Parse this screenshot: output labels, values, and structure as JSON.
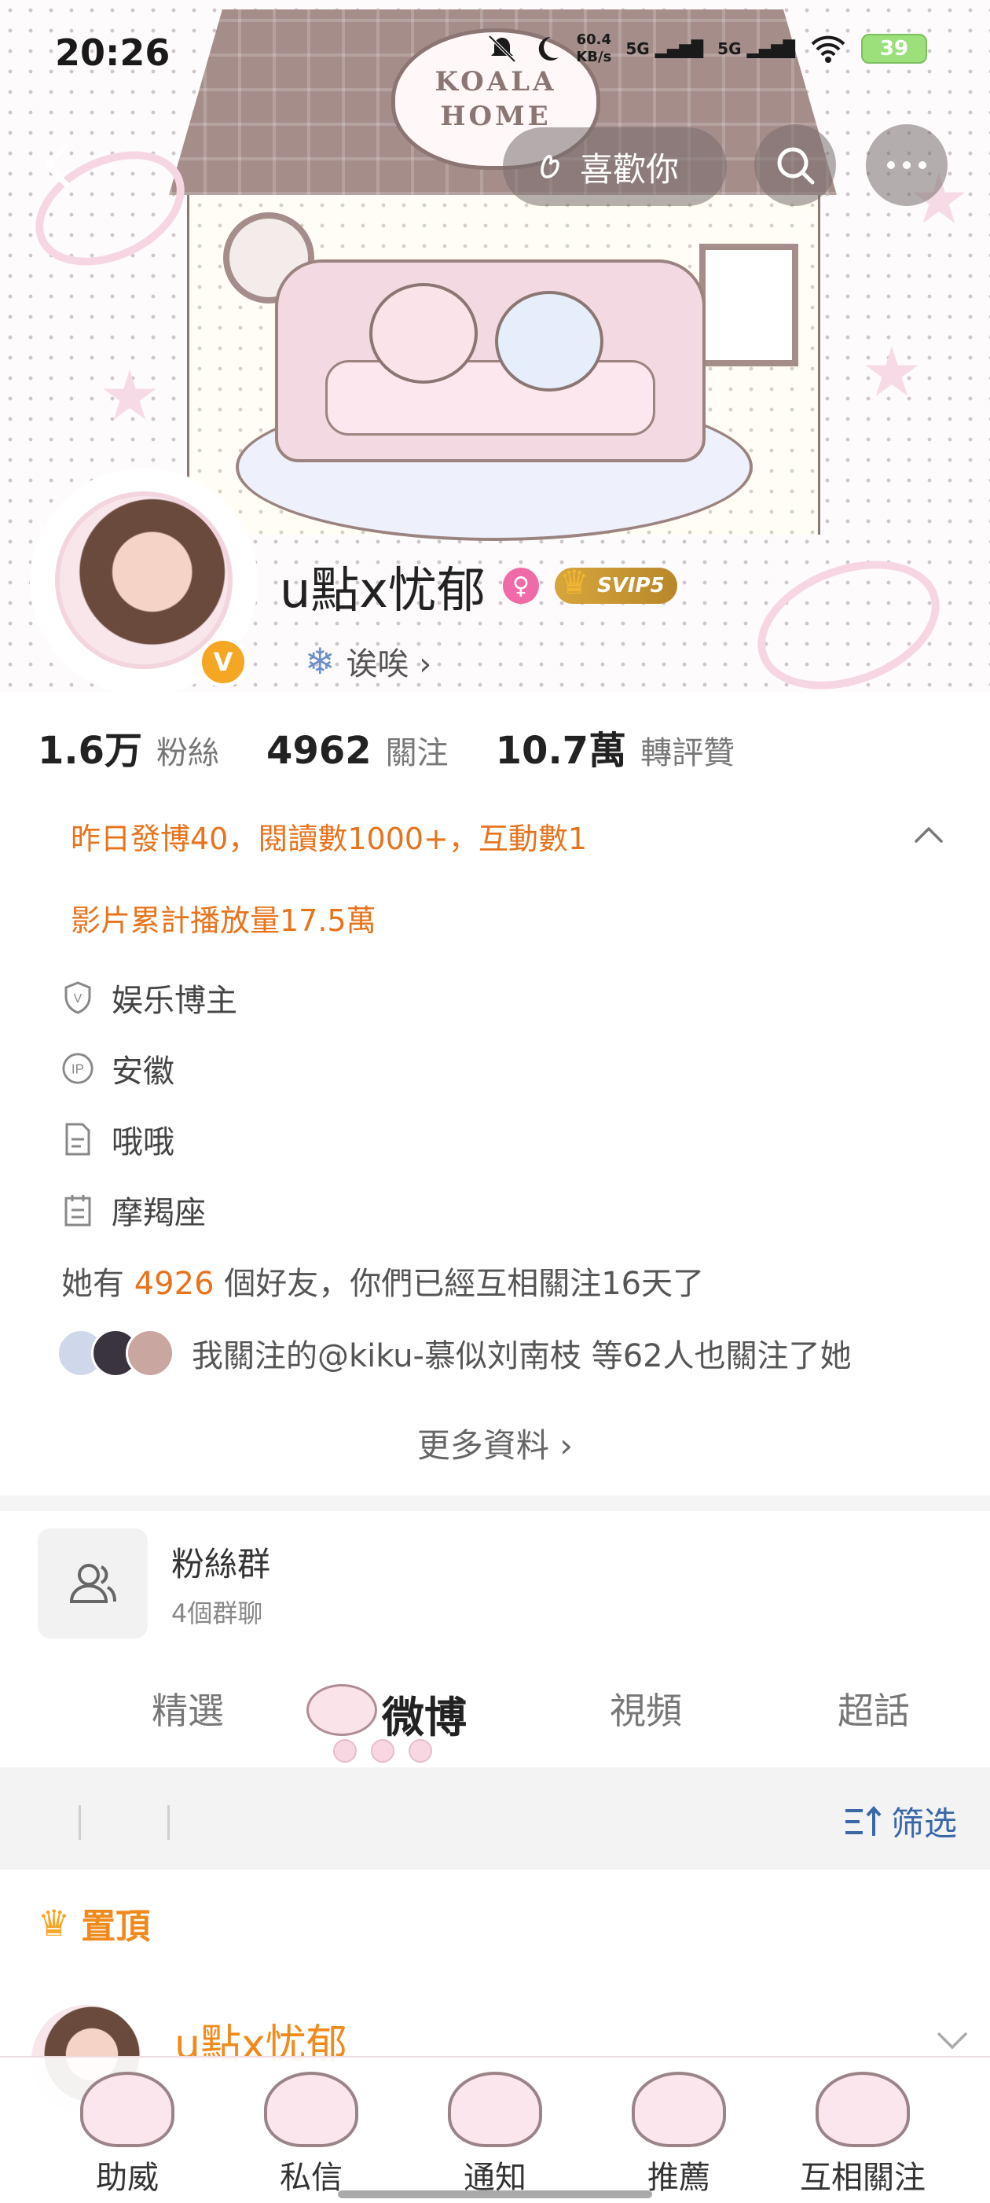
{
  "status_bar": {
    "time": "20:26",
    "net_speed_value": "60.4",
    "net_speed_unit": "KB/s",
    "sig1": "5G",
    "sig2": "5G",
    "battery": "39"
  },
  "banner": {
    "sign_line1": "KOALA",
    "sign_line2": "HOME"
  },
  "top_nav": {
    "like_label": "喜歡你"
  },
  "profile": {
    "username": "u點x忧郁",
    "svip_label": "SVIP5",
    "verified_mark": "V",
    "bio": "诶唉 ›",
    "stats": [
      {
        "num": "1.6万",
        "label": "粉絲"
      },
      {
        "num": "4962",
        "label": "關注"
      },
      {
        "num": "10.7萬",
        "label": "轉評贊"
      }
    ]
  },
  "activity": {
    "line1": "昨日發博40，閱讀數1000+，互動數1",
    "line2": "影片累計播放量17.5萬"
  },
  "info": {
    "category": "娱乐博主",
    "ip": "安徽",
    "intro": "哦哦",
    "zodiac": "摩羯座",
    "ip_badge": "IP",
    "shield_mark": "V"
  },
  "friends": {
    "prefix": "她有 ",
    "count": "4926",
    "suffix": " 個好友，你們已經互相關注16天了",
    "mutual_text": "我關注的@kiku-慕似刘南枝 等62人也關注了她"
  },
  "more_label": "更多資料 ›",
  "fan_group": {
    "name": "粉絲群",
    "sub": "4個群聊"
  },
  "tabs": [
    "精選",
    "微博",
    "視頻",
    "超話"
  ],
  "filter_label": "筛选",
  "pinned_label": "置頂",
  "post": {
    "username": "u點x忧郁"
  },
  "bottom_nav": [
    "助威",
    "私信",
    "通知",
    "推薦",
    "互相關注"
  ],
  "colors": {
    "accent_orange": "#e8731c",
    "link_blue": "#3a67a8",
    "svip_gold": "#d7a63c"
  }
}
